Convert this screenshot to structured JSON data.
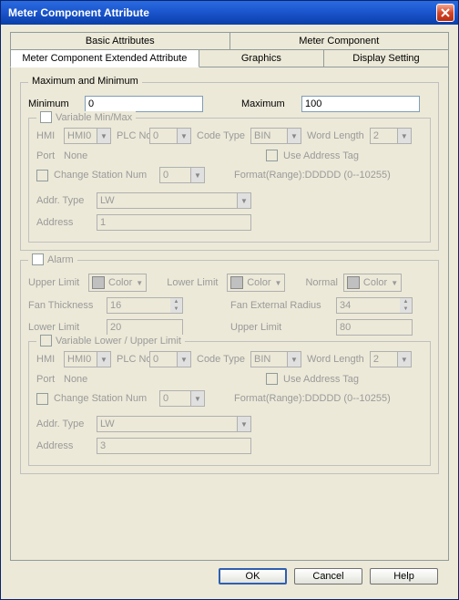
{
  "window": {
    "title": "Meter Component Attribute"
  },
  "tabs": {
    "row1": [
      {
        "label": "Basic Attributes",
        "active": false
      },
      {
        "label": "Meter Component",
        "active": false
      }
    ],
    "row2": [
      {
        "label": "Meter Component Extended Attribute",
        "active": true
      },
      {
        "label": "Graphics",
        "active": false
      },
      {
        "label": "Display Setting",
        "active": false
      }
    ]
  },
  "maxmin": {
    "legend": "Maximum and Minimum",
    "min_label": "Minimum",
    "min_value": "0",
    "max_label": "Maximum",
    "max_value": "100",
    "var_legend": "Variable Min/Max",
    "hmi_label": "HMI",
    "hmi_value": "HMI0",
    "plc_label": "PLC No.",
    "plc_value": "0",
    "code_label": "Code Type",
    "code_value": "BIN",
    "wordlen_label": "Word Length",
    "wordlen_value": "2",
    "port_label": "Port",
    "port_value": "None",
    "use_addrtag_label": "Use Address Tag",
    "change_station_label": "Change Station Num",
    "change_station_value": "0",
    "format_label": "Format(Range):DDDDD (0--10255)",
    "addrtype_label": "Addr. Type",
    "addrtype_value": "LW",
    "address_label": "Address",
    "address_value": "1"
  },
  "alarm": {
    "legend": "Alarm",
    "upper_limit_label": "Upper Limit",
    "lower_limit_label": "Lower Limit",
    "normal_label": "Normal",
    "color_label": "Color",
    "fan_thickness_label": "Fan Thickness",
    "fan_thickness_value": "16",
    "fan_radius_label": "Fan External Radius",
    "fan_radius_value": "34",
    "lower_limit2_label": "Lower Limit",
    "lower_limit2_value": "20",
    "upper_limit2_label": "Upper Limit",
    "upper_limit2_value": "80",
    "var_legend": "Variable Lower / Upper Limit",
    "hmi_label": "HMI",
    "hmi_value": "HMI0",
    "plc_label": "PLC No.",
    "plc_value": "0",
    "code_label": "Code Type",
    "code_value": "BIN",
    "wordlen_label": "Word Length",
    "wordlen_value": "2",
    "port_label": "Port",
    "port_value": "None",
    "use_addrtag_label": "Use Address Tag",
    "change_station_label": "Change Station Num",
    "change_station_value": "0",
    "format_label": "Format(Range):DDDDD (0--10255)",
    "addrtype_label": "Addr. Type",
    "addrtype_value": "LW",
    "address_label": "Address",
    "address_value": "3"
  },
  "buttons": {
    "ok": "OK",
    "cancel": "Cancel",
    "help": "Help"
  }
}
